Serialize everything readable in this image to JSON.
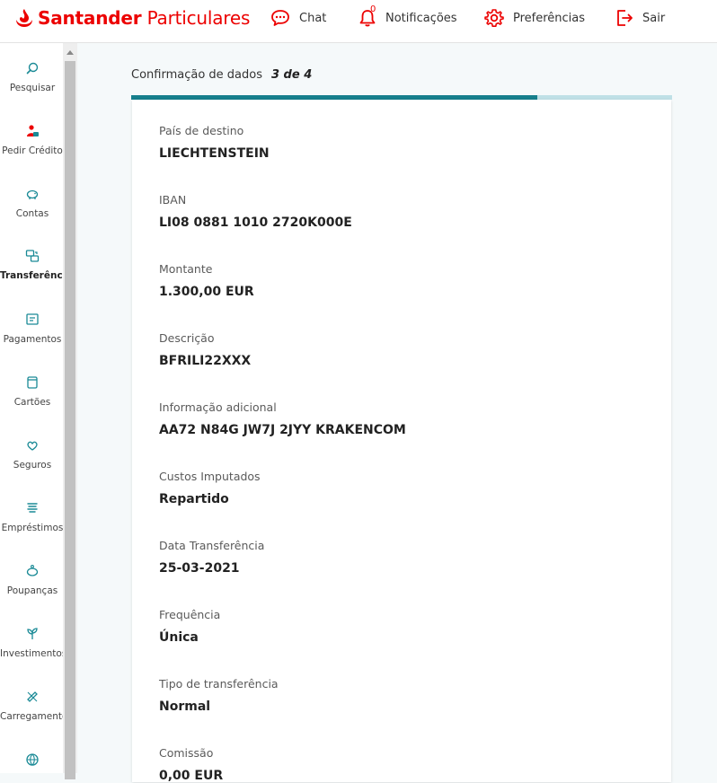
{
  "header": {
    "brand_bold": "Santander",
    "brand_rest": "Particulares",
    "nav": [
      {
        "label": "Chat",
        "icon": "chat-icon"
      },
      {
        "label": "Notificações",
        "icon": "bell-icon",
        "badge": "0"
      },
      {
        "label": "Preferências",
        "icon": "gear-icon"
      },
      {
        "label": "Sair",
        "icon": "logout-icon"
      }
    ]
  },
  "sidebar": {
    "items": [
      {
        "label": "Pesquisar",
        "icon": "search-icon"
      },
      {
        "label": "Pedir Crédito",
        "icon": "credit-request-icon"
      },
      {
        "label": "Contas",
        "icon": "piggy-icon"
      },
      {
        "label": "Transferências",
        "icon": "transfer-icon",
        "active": true
      },
      {
        "label": "Pagamentos",
        "icon": "payment-icon"
      },
      {
        "label": "Cartões",
        "icon": "card-icon"
      },
      {
        "label": "Seguros",
        "icon": "insurance-icon"
      },
      {
        "label": "Empréstimos",
        "icon": "loan-icon"
      },
      {
        "label": "Poupanças",
        "icon": "savings-icon"
      },
      {
        "label": "Investimentos",
        "icon": "investment-icon"
      },
      {
        "label": "Carregamento",
        "icon": "topup-icon"
      },
      {
        "label": "",
        "icon": "globe-icon"
      }
    ]
  },
  "main": {
    "title": "Confirmação de dados",
    "step": "3 de 4",
    "progress": 0.75,
    "fields": [
      {
        "label": "País de destino",
        "value": "LIECHTENSTEIN"
      },
      {
        "label": "IBAN",
        "value": "LI08 0881 1010 2720K000E"
      },
      {
        "label": "Montante",
        "value": "1.300,00 EUR"
      },
      {
        "label": "Descrição",
        "value": "BFRILI22XXX"
      },
      {
        "label": "Informação adicional",
        "value": "AA72 N84G JW7J 2JYY KRAKENCOM"
      },
      {
        "label": "Custos Imputados",
        "value": "Repartido"
      },
      {
        "label": "Data Transferência",
        "value": "25-03-2021"
      },
      {
        "label": "Frequência",
        "value": "Única"
      },
      {
        "label": "Tipo de transferência",
        "value": "Normal"
      },
      {
        "label": "Comissão",
        "value": "0,00 EUR"
      }
    ]
  },
  "colors": {
    "brand": "#ec0000",
    "accent": "#167f8c",
    "track": "#bfe0e6"
  }
}
